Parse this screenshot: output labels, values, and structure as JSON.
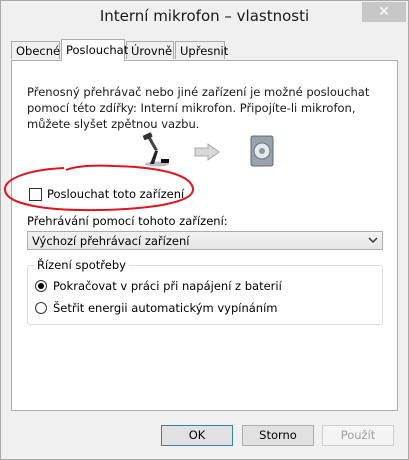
{
  "window": {
    "title": "Interní mikrofon – vlastnosti",
    "close_glyph": "✕"
  },
  "tabs": [
    {
      "label": "Obecné",
      "active": false
    },
    {
      "label": "Poslouchat",
      "active": true
    },
    {
      "label": "Úrovně",
      "active": false
    },
    {
      "label": "Upřesnit",
      "active": false
    }
  ],
  "listen": {
    "description": "Přenosný přehrávač nebo jiné zařízení je možné poslouchat pomocí této zdířky: Interní mikrofon. Připojíte-li mikrofon, můžete slyšet zpětnou vazbu.",
    "listen_checkbox_label": "Poslouchat toto zařízení",
    "listen_checked": false,
    "playback_label": "Přehrávání pomocí tohoto zařízení:",
    "playback_device": "Výchozí přehrávací zařízení"
  },
  "power": {
    "legend": "Řízení spotřeby",
    "options": [
      {
        "label": "Pokračovat v práci při napájení z baterií",
        "selected": true
      },
      {
        "label": "Šetřit energii automatickým vypínáním",
        "selected": false
      }
    ]
  },
  "buttons": {
    "ok": "OK",
    "cancel": "Storno",
    "apply": "Použít"
  },
  "icons": [
    "microphone-icon",
    "arrow-right-icon",
    "speaker-icon",
    "chevron-down-icon",
    "close-icon"
  ],
  "colors": {
    "annotation_circle": "#e0141e",
    "accent_border": "#3c7fb1"
  }
}
